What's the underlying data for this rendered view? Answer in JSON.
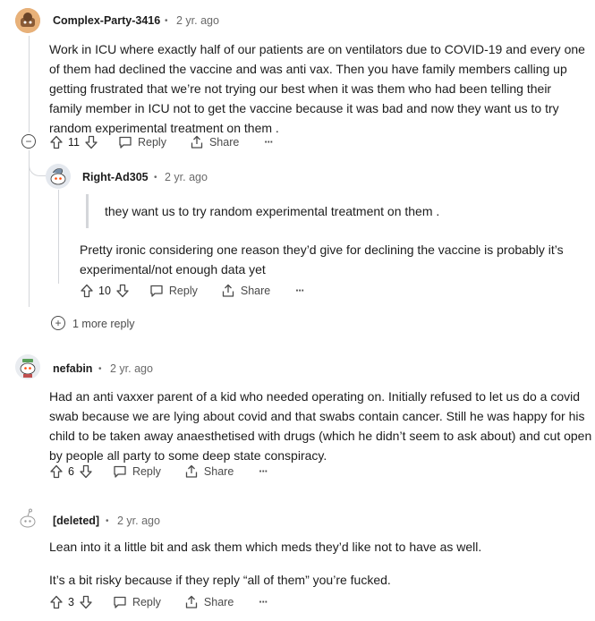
{
  "comments": [
    {
      "username": "Complex-Party-3416",
      "time": "2 yr. ago",
      "lines": [
        "Work in ICU where exactly half of our patients are on ventilators due to COVID-19 and every one",
        "of them had declined the vaccine and was anti vax. Then you have family members calling up",
        "getting frustrated that we’re not trying our best when it was them who had been telling their",
        "family member in ICU not to get the vaccine because it was bad and now they want us to try",
        "random experimental treatment on them ."
      ],
      "score": "11"
    },
    {
      "username": "Right-Ad305",
      "time": "2 yr. ago",
      "quote": "they want us to try random experimental treatment on them .",
      "lines": [
        "Pretty ironic considering one reason they’d give for declining the vaccine is probably it’s",
        "experimental/not enough data yet"
      ],
      "score": "10"
    },
    {
      "username": "nefabin",
      "time": "2 yr. ago",
      "lines": [
        "Had an anti vaxxer parent of a kid who needed operating on. Initially refused to let us do a covid",
        "swab because we are lying about covid and that swabs contain cancer. Still he was happy for his",
        "child to be taken away anaesthetised with drugs (which he didn’t seem to ask about) and cut open",
        "by people all party to some deep state conspiracy."
      ],
      "score": "6"
    },
    {
      "username": "[deleted]",
      "time": "2 yr. ago",
      "paragraphs": [
        "Lean into it a little bit and ask them which meds they’d like not to have as well.",
        "It’s a bit risky because if they reply “all of them” you’re fucked."
      ],
      "score": "3"
    }
  ],
  "labels": {
    "reply": "Reply",
    "share": "Share",
    "more": "···",
    "separator": "•",
    "more_replies": "1 more reply",
    "collapse": "−",
    "expand": "+"
  },
  "colors": {
    "text": "#1c1c1c",
    "meta": "#6a6a6a",
    "thread_line": "#d4d6da"
  },
  "icons": [
    "upvote-icon",
    "downvote-icon",
    "comment-icon",
    "share-icon",
    "overflow-icon",
    "collapse-icon",
    "expand-icon"
  ]
}
